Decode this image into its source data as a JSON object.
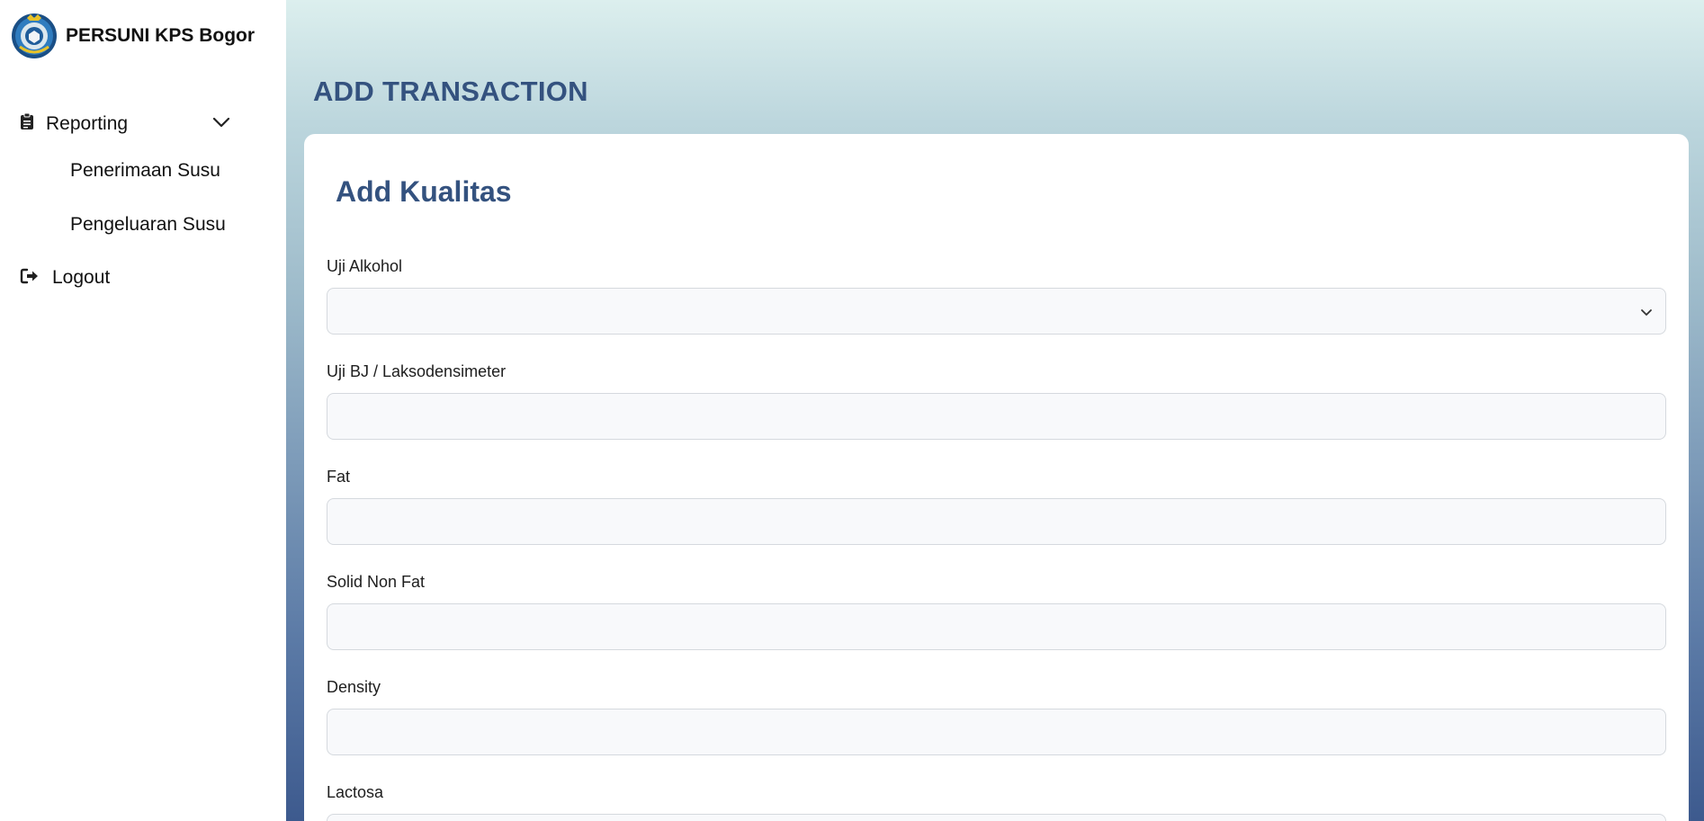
{
  "brand": {
    "name": "PERSUNI KPS Bogor",
    "logo_icon": "persuni-emblem-icon"
  },
  "sidebar": {
    "reporting": {
      "label": "Reporting",
      "icon": "clipboard-icon"
    },
    "sub_items": [
      {
        "label": "Penerimaan Susu"
      },
      {
        "label": "Pengeluaran Susu"
      }
    ],
    "logout": {
      "label": "Logout",
      "icon": "sign-out-icon"
    }
  },
  "page": {
    "title": "ADD TRANSACTION"
  },
  "form": {
    "title": "Add Kualitas",
    "fields": [
      {
        "label": "Uji Alkohol",
        "type": "select",
        "value": ""
      },
      {
        "label": "Uji BJ / Laksodensimeter",
        "type": "text",
        "value": ""
      },
      {
        "label": "Fat",
        "type": "text",
        "value": ""
      },
      {
        "label": "Solid Non Fat",
        "type": "text",
        "value": ""
      },
      {
        "label": "Density",
        "type": "text",
        "value": ""
      },
      {
        "label": "Lactosa",
        "type": "text",
        "value": ""
      }
    ]
  },
  "colors": {
    "accent": "#34527f",
    "gradient_top": "#dcefee",
    "gradient_bottom": "#3d5a8e",
    "logo_gold": "#e8c227",
    "logo_blue": "#2f7cbf"
  }
}
